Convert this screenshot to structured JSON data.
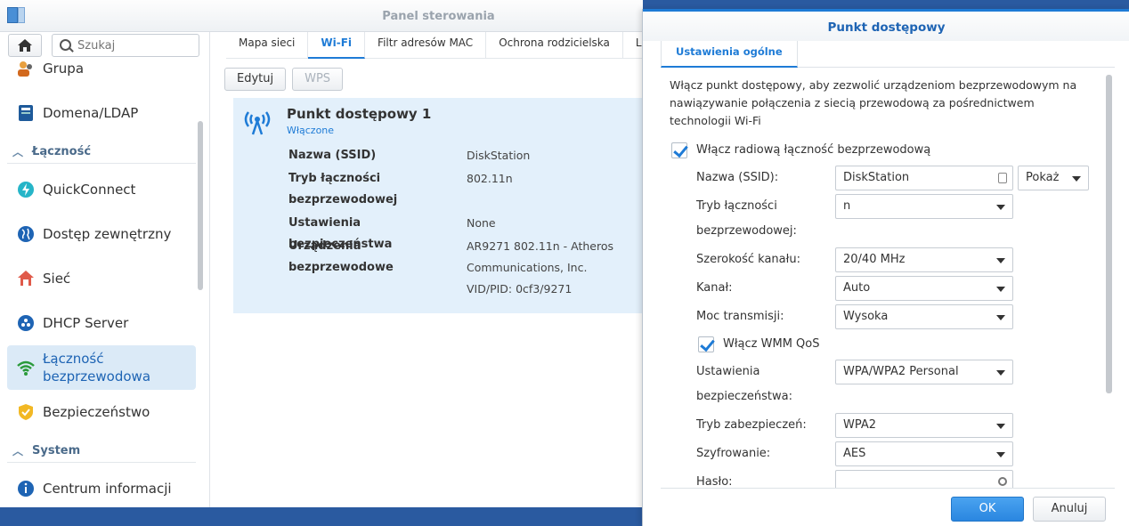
{
  "window": {
    "title": "Panel sterowania"
  },
  "search": {
    "placeholder": "Szukaj"
  },
  "sidebar": {
    "items": [
      {
        "label": "Grupa"
      },
      {
        "label": "Domena/LDAP"
      },
      {
        "label": "Łączność"
      },
      {
        "label": "QuickConnect"
      },
      {
        "label": "Dostęp zewnętrzny"
      },
      {
        "label": "Sieć"
      },
      {
        "label": "DHCP Server"
      },
      {
        "label": "Łączność bezprzewodowa"
      },
      {
        "label": "Bezpieczeństwo"
      },
      {
        "label": "System"
      },
      {
        "label": "Centrum informacji"
      }
    ]
  },
  "tabs": [
    {
      "label": "Mapa sieci"
    },
    {
      "label": "Wi-Fi"
    },
    {
      "label": "Filtr adresów MAC"
    },
    {
      "label": "Ochrona rodzicielska"
    },
    {
      "label": "Li"
    }
  ],
  "toolbar": {
    "edit_label": "Edytuj",
    "wps_label": "WPS"
  },
  "access_point": {
    "title": "Punkt dostępowy 1",
    "status": "Włączone",
    "rows": [
      {
        "key": "Nazwa (SSID)",
        "value": "DiskStation"
      },
      {
        "key": "Tryb łączności bezprzewodowej",
        "value": "802.11n"
      },
      {
        "key": "Ustawienia bezpieczeństwa",
        "value": "None"
      },
      {
        "key": "Urządzenia bezprzewodowe",
        "value": "AR9271 802.11n - Atheros Communications, Inc."
      },
      {
        "key": "",
        "value": "VID/PID: 0cf3/9271"
      }
    ]
  },
  "dialog": {
    "title": "Punkt dostępowy",
    "tab": "Ustawienia ogólne",
    "description": "Włącz punkt dostępowy, aby zezwolić urządzeniom bezprzewodowym na nawiązywanie połączenia z siecią przewodową za pośrednictwem technologii Wi-Fi",
    "enable_radio_label": "Włącz radiową łączność bezprzewodową",
    "fields": {
      "ssid_label": "Nazwa (SSID):",
      "ssid_value": "DiskStation",
      "show_label": "Pokaż",
      "mode_label": "Tryb łączności bezprzewodowej:",
      "mode_value": "n",
      "width_label": "Szerokość kanału:",
      "width_value": "20/40 MHz",
      "channel_label": "Kanał:",
      "channel_value": "Auto",
      "power_label": "Moc transmisji:",
      "power_value": "Wysoka",
      "wmm_label": "Włącz WMM QoS",
      "security_label": "Ustawienia bezpieczeństwa:",
      "security_value": "WPA/WPA2 Personal",
      "sec_mode_label": "Tryb zabezpieczeń:",
      "sec_mode_value": "WPA2",
      "encryption_label": "Szyfrowanie:",
      "encryption_value": "AES",
      "password_label": "Hasło:"
    },
    "ok_label": "OK",
    "cancel_label": "Anuluj"
  },
  "colors": {
    "accent": "#1e7bd6",
    "active_bg": "#dbeaf7",
    "panel_bg": "#e3f0fb"
  }
}
